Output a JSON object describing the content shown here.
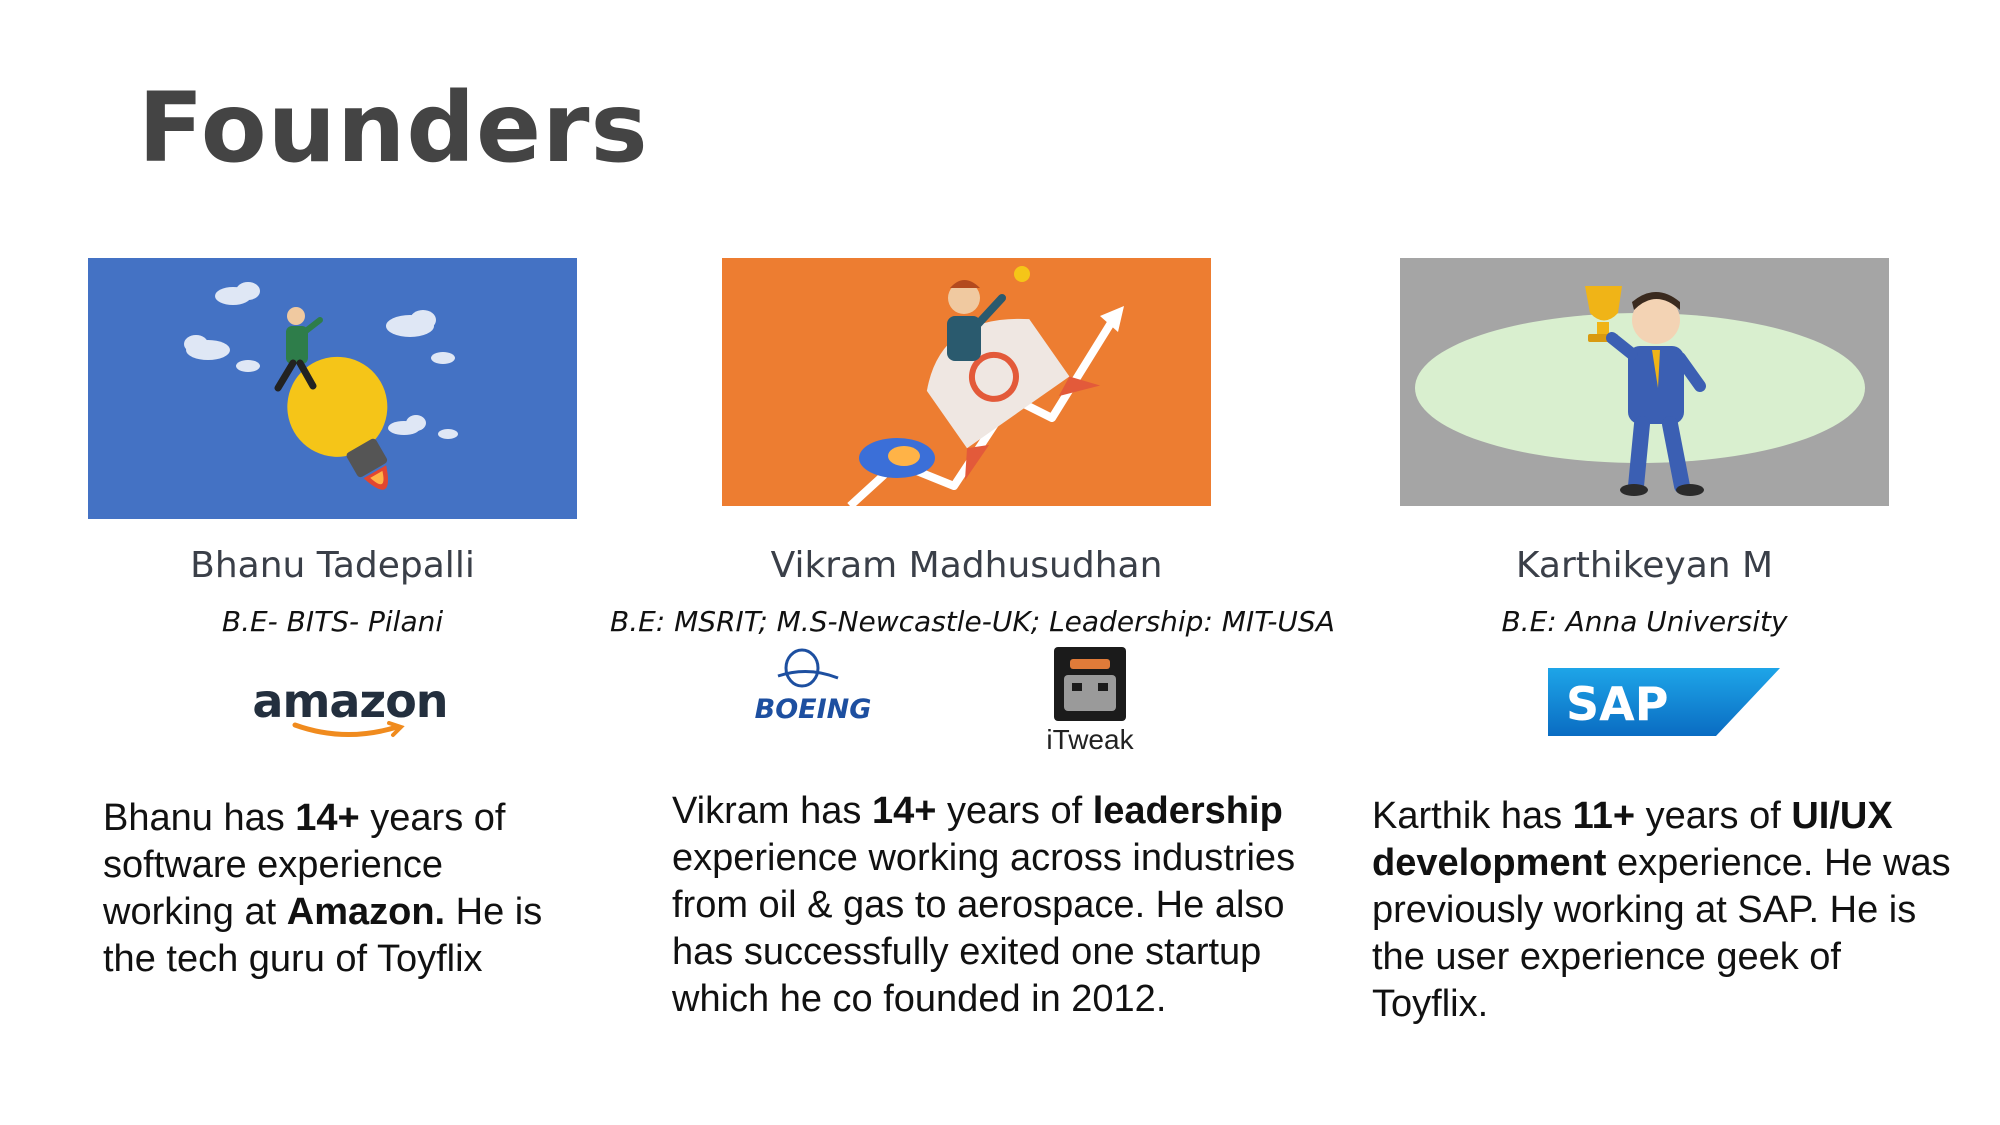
{
  "slide": {
    "title": "Founders"
  },
  "founders": [
    {
      "name": "Bhanu Tadepalli",
      "education": "B.E- BITS- Pilani",
      "logos": [
        {
          "text": "amazon",
          "icon": "amazon-logo-icon"
        }
      ],
      "bio": {
        "p1": "Bhanu has ",
        "b1": "14+",
        "p2": " years of software experience working at ",
        "b2": "Amazon.",
        "p3": " He is the tech guru of Toyflix"
      },
      "illustration": {
        "icon": "man-riding-lightbulb-rocket-icon",
        "bg_color": "#4472c4"
      }
    },
    {
      "name": "Vikram Madhusudhan",
      "education": "B.E: MSRIT; M.S-Newcastle-UK; Leadership: MIT-USA",
      "logos": [
        {
          "text": "BOEING",
          "icon": "boeing-logo-icon"
        },
        {
          "text": "iTweak",
          "icon": "itweak-logo-icon"
        }
      ],
      "bio": {
        "p1": "Vikram has ",
        "b1": "14+",
        "p2": " years of ",
        "b2": "leadership",
        "p3": " experience working across industries from oil & gas to aerospace. He also has successfully exited one startup which he co founded in 2012."
      },
      "illustration": {
        "icon": "man-riding-rocket-icon",
        "bg_color": "#ed7d31"
      }
    },
    {
      "name": "Karthikeyan M",
      "education": "B.E: Anna University",
      "logos": [
        {
          "text": "SAP",
          "icon": "sap-logo-icon"
        }
      ],
      "bio": {
        "p1": "Karthik has ",
        "b1": "11+",
        "p2": " years of ",
        "b2": "UI/UX development",
        "p3": " experience. He was previously working at SAP. He is the user experience geek of Toyflix."
      },
      "illustration": {
        "icon": "man-holding-trophy-icon",
        "bg_color": "#a5a5a5"
      }
    }
  ]
}
